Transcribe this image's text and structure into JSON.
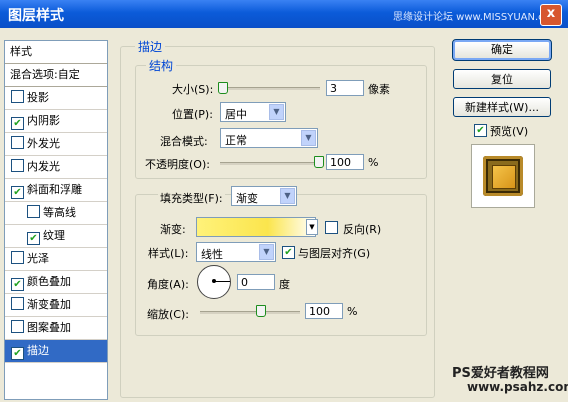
{
  "window": {
    "title": "图层样式",
    "watermark": "思缘设计论坛 www.MISSYUAN.com",
    "close_label": "x"
  },
  "sidebar": {
    "header": "样式",
    "blend": "混合选项:自定",
    "items": [
      {
        "label": "投影",
        "checked": false
      },
      {
        "label": "内阴影",
        "checked": true
      },
      {
        "label": "外发光",
        "checked": false
      },
      {
        "label": "内发光",
        "checked": false
      },
      {
        "label": "斜面和浮雕",
        "checked": true
      },
      {
        "label": "等高线",
        "checked": false
      },
      {
        "label": "纹理",
        "checked": true
      },
      {
        "label": "光泽",
        "checked": false
      },
      {
        "label": "颜色叠加",
        "checked": true
      },
      {
        "label": "渐变叠加",
        "checked": false
      },
      {
        "label": "图案叠加",
        "checked": false
      },
      {
        "label": "描边",
        "checked": true
      }
    ]
  },
  "stroke": {
    "group_title": "描边",
    "structure_title": "结构",
    "size_label": "大小(S):",
    "size_value": "3",
    "size_unit": "像素",
    "position_label": "位置(P):",
    "position_value": "居中",
    "blend_mode_label": "混合模式:",
    "blend_mode_value": "正常",
    "opacity_label": "不透明度(O):",
    "opacity_value": "100",
    "opacity_unit": "%",
    "fill_type_label": "填充类型(F):",
    "fill_type_value": "渐变",
    "gradient_label": "渐变:",
    "reverse_label": "反向(R)",
    "style_label": "样式(L):",
    "style_value": "线性",
    "align_label": "与图层对齐(G)",
    "angle_label": "角度(A):",
    "angle_value": "0",
    "angle_unit": "度",
    "scale_label": "缩放(C):",
    "scale_value": "100",
    "scale_unit": "%"
  },
  "buttons": {
    "ok": "确定",
    "reset": "复位",
    "new_style": "新建样式(W)...",
    "preview": "预览(V)"
  },
  "footer": {
    "line1": "PS爱好者教程网",
    "line2": "www.psahz.com"
  }
}
